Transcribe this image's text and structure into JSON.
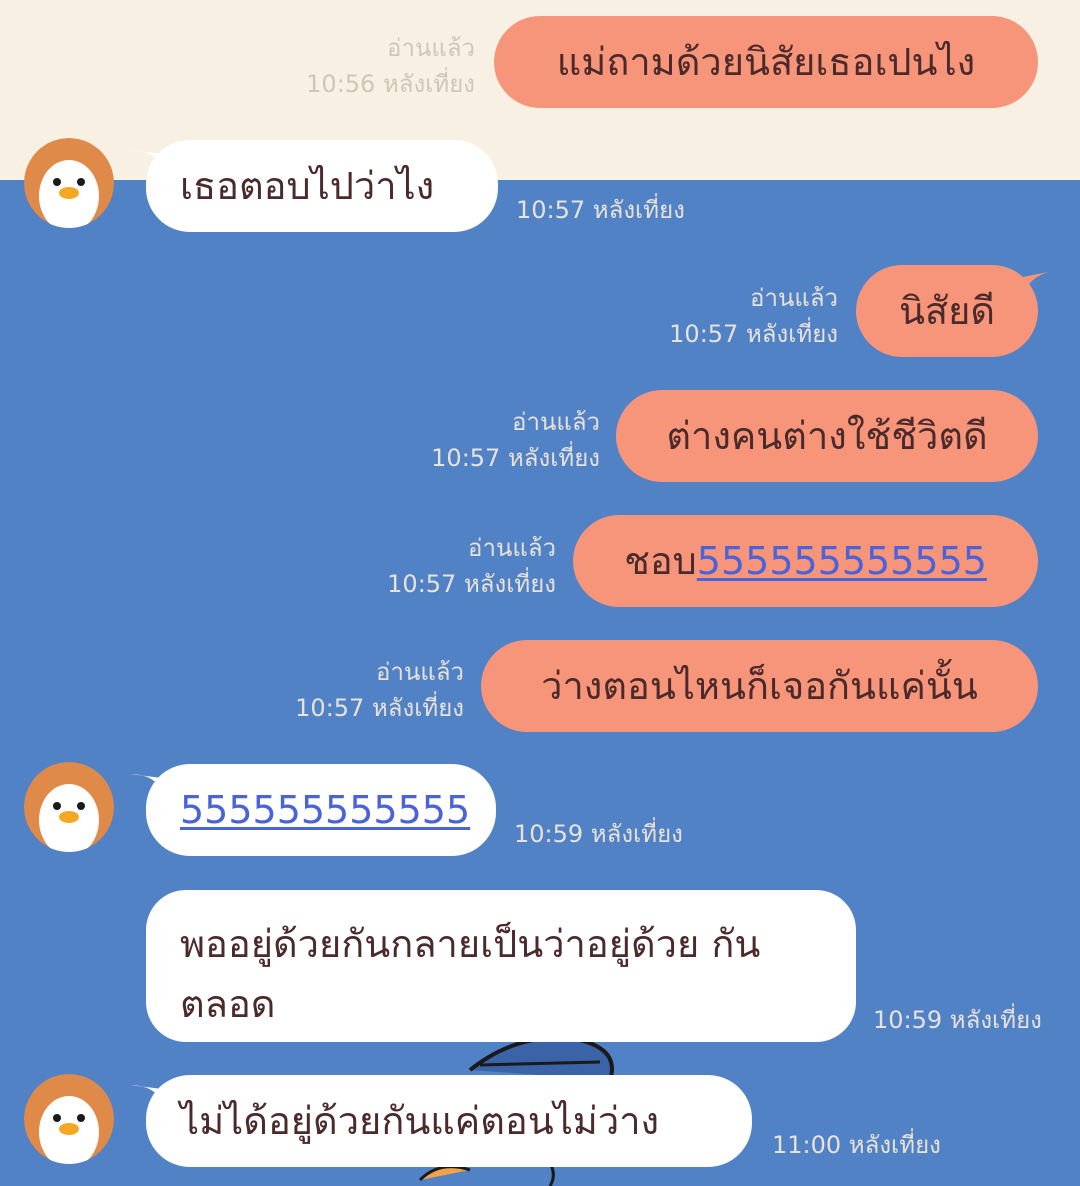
{
  "messages": [
    {
      "side": "out",
      "text": "แม่ถามด้วยนิสัยเธอเปนไง",
      "read": "อ่านแล้ว",
      "time": "10:56 หลังเที่ยง"
    },
    {
      "side": "in",
      "text": "เธอตอบไปว่าไง",
      "time": "10:57 หลังเที่ยง"
    },
    {
      "side": "out",
      "text": "นิสัยดี",
      "read": "อ่านแล้ว",
      "time": "10:57 หลังเที่ยง"
    },
    {
      "side": "out",
      "text": "ต่างคนต่างใช้ชีวิตดี",
      "read": "อ่านแล้ว",
      "time": "10:57 หลังเที่ยง"
    },
    {
      "side": "out",
      "text_prefix": "ชอบ",
      "link": "555555555555",
      "read": "อ่านแล้ว",
      "time": "10:57 หลังเที่ยง"
    },
    {
      "side": "out",
      "text": "ว่างตอนไหนก็เจอกันแค่นั้น",
      "read": "อ่านแล้ว",
      "time": "10:57 หลังเที่ยง"
    },
    {
      "side": "in",
      "link": "555555555555",
      "time": "10:59 หลังเที่ยง"
    },
    {
      "side": "in",
      "text": "พออยู่ด้วยกันกลายเป็นว่าอยู่ด้วย กันตลอด",
      "time": "10:59 หลังเที่ยง"
    },
    {
      "side": "in",
      "text": "ไม่ได้อยู่ด้วยกันแค่ตอนไม่ว่าง",
      "time": "11:00 หลังเที่ยง"
    }
  ],
  "colors": {
    "background_top": "#f8f1e3",
    "background_chat": "#5182c6",
    "outgoing_bubble": "#f7957a",
    "incoming_bubble": "#ffffff",
    "text": "#4a2a2a",
    "link": "#4a63d8",
    "avatar": "#e08a4a"
  },
  "icons": {
    "avatar": "penguin-avatar-icon"
  }
}
